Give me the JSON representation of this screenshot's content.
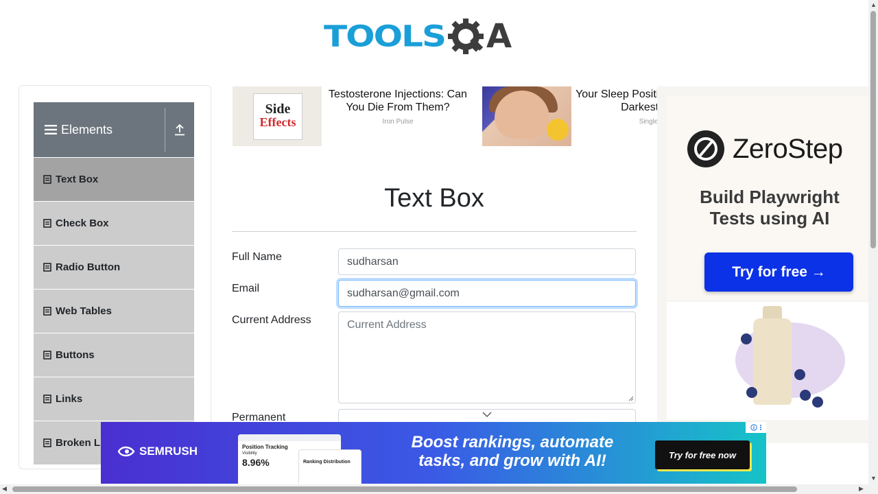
{
  "header": {
    "logo_tools": "TOOLS",
    "logo_a": "A"
  },
  "sidebar": {
    "group_title": "Elements",
    "items": [
      {
        "label": "Text Box",
        "active": true
      },
      {
        "label": "Check Box"
      },
      {
        "label": "Radio Button"
      },
      {
        "label": "Web Tables"
      },
      {
        "label": "Buttons"
      },
      {
        "label": "Links"
      },
      {
        "label": "Broken Links - Images"
      }
    ]
  },
  "ads": {
    "card1": {
      "img_line1": "Side",
      "img_line2": "Effects",
      "headline": "Testosterone Injections: Can You Die From Them?",
      "source": "Iron Pulse"
    },
    "card2": {
      "headline": "Your Sleep Position Reveals Your Darkest Secret",
      "source": "Single Mom"
    }
  },
  "form": {
    "title": "Text Box",
    "full_name_label": "Full Name",
    "full_name_value": "sudharsan",
    "email_label": "Email",
    "email_value": "sudharsan@gmail.com",
    "current_address_label": "Current Address",
    "current_address_placeholder": "Current Address",
    "permanent_address_label": "Permanent"
  },
  "right_ad": {
    "brand": "ZeroStep",
    "subtitle_line1": "Build Playwright",
    "subtitle_line2": "Tests using AI",
    "cta": "Try for free →"
  },
  "bottom_ad": {
    "brand": "SEMRUSH",
    "shot1_title": "Position Tracking",
    "shot1_sub": "Visibility",
    "shot1_value": "8.96%",
    "shot2_title": "Ranking Distribution",
    "headline_line1": "Boost rankings, automate",
    "headline_line2": "tasks, and grow with AI!",
    "cta": "Try for free now"
  },
  "colors": {
    "accent_blue": "#1a9fd8",
    "sidebar_header": "#6c757d",
    "menu_bg": "#cccccc",
    "menu_active": "#a3a3a3",
    "zerostep_button": "#0b32e6"
  }
}
